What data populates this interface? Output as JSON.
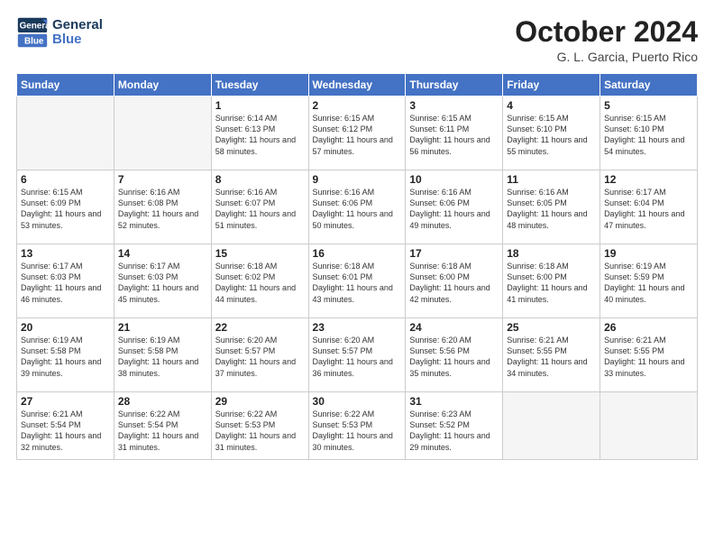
{
  "header": {
    "logo_line1": "General",
    "logo_line2": "Blue",
    "month": "October 2024",
    "location": "G. L. Garcia, Puerto Rico"
  },
  "weekdays": [
    "Sunday",
    "Monday",
    "Tuesday",
    "Wednesday",
    "Thursday",
    "Friday",
    "Saturday"
  ],
  "weeks": [
    [
      {
        "day": "",
        "sunrise": "",
        "sunset": "",
        "daylight": ""
      },
      {
        "day": "",
        "sunrise": "",
        "sunset": "",
        "daylight": ""
      },
      {
        "day": "1",
        "sunrise": "Sunrise: 6:14 AM",
        "sunset": "Sunset: 6:13 PM",
        "daylight": "Daylight: 11 hours and 58 minutes."
      },
      {
        "day": "2",
        "sunrise": "Sunrise: 6:15 AM",
        "sunset": "Sunset: 6:12 PM",
        "daylight": "Daylight: 11 hours and 57 minutes."
      },
      {
        "day": "3",
        "sunrise": "Sunrise: 6:15 AM",
        "sunset": "Sunset: 6:11 PM",
        "daylight": "Daylight: 11 hours and 56 minutes."
      },
      {
        "day": "4",
        "sunrise": "Sunrise: 6:15 AM",
        "sunset": "Sunset: 6:10 PM",
        "daylight": "Daylight: 11 hours and 55 minutes."
      },
      {
        "day": "5",
        "sunrise": "Sunrise: 6:15 AM",
        "sunset": "Sunset: 6:10 PM",
        "daylight": "Daylight: 11 hours and 54 minutes."
      }
    ],
    [
      {
        "day": "6",
        "sunrise": "Sunrise: 6:15 AM",
        "sunset": "Sunset: 6:09 PM",
        "daylight": "Daylight: 11 hours and 53 minutes."
      },
      {
        "day": "7",
        "sunrise": "Sunrise: 6:16 AM",
        "sunset": "Sunset: 6:08 PM",
        "daylight": "Daylight: 11 hours and 52 minutes."
      },
      {
        "day": "8",
        "sunrise": "Sunrise: 6:16 AM",
        "sunset": "Sunset: 6:07 PM",
        "daylight": "Daylight: 11 hours and 51 minutes."
      },
      {
        "day": "9",
        "sunrise": "Sunrise: 6:16 AM",
        "sunset": "Sunset: 6:06 PM",
        "daylight": "Daylight: 11 hours and 50 minutes."
      },
      {
        "day": "10",
        "sunrise": "Sunrise: 6:16 AM",
        "sunset": "Sunset: 6:06 PM",
        "daylight": "Daylight: 11 hours and 49 minutes."
      },
      {
        "day": "11",
        "sunrise": "Sunrise: 6:16 AM",
        "sunset": "Sunset: 6:05 PM",
        "daylight": "Daylight: 11 hours and 48 minutes."
      },
      {
        "day": "12",
        "sunrise": "Sunrise: 6:17 AM",
        "sunset": "Sunset: 6:04 PM",
        "daylight": "Daylight: 11 hours and 47 minutes."
      }
    ],
    [
      {
        "day": "13",
        "sunrise": "Sunrise: 6:17 AM",
        "sunset": "Sunset: 6:03 PM",
        "daylight": "Daylight: 11 hours and 46 minutes."
      },
      {
        "day": "14",
        "sunrise": "Sunrise: 6:17 AM",
        "sunset": "Sunset: 6:03 PM",
        "daylight": "Daylight: 11 hours and 45 minutes."
      },
      {
        "day": "15",
        "sunrise": "Sunrise: 6:18 AM",
        "sunset": "Sunset: 6:02 PM",
        "daylight": "Daylight: 11 hours and 44 minutes."
      },
      {
        "day": "16",
        "sunrise": "Sunrise: 6:18 AM",
        "sunset": "Sunset: 6:01 PM",
        "daylight": "Daylight: 11 hours and 43 minutes."
      },
      {
        "day": "17",
        "sunrise": "Sunrise: 6:18 AM",
        "sunset": "Sunset: 6:00 PM",
        "daylight": "Daylight: 11 hours and 42 minutes."
      },
      {
        "day": "18",
        "sunrise": "Sunrise: 6:18 AM",
        "sunset": "Sunset: 6:00 PM",
        "daylight": "Daylight: 11 hours and 41 minutes."
      },
      {
        "day": "19",
        "sunrise": "Sunrise: 6:19 AM",
        "sunset": "Sunset: 5:59 PM",
        "daylight": "Daylight: 11 hours and 40 minutes."
      }
    ],
    [
      {
        "day": "20",
        "sunrise": "Sunrise: 6:19 AM",
        "sunset": "Sunset: 5:58 PM",
        "daylight": "Daylight: 11 hours and 39 minutes."
      },
      {
        "day": "21",
        "sunrise": "Sunrise: 6:19 AM",
        "sunset": "Sunset: 5:58 PM",
        "daylight": "Daylight: 11 hours and 38 minutes."
      },
      {
        "day": "22",
        "sunrise": "Sunrise: 6:20 AM",
        "sunset": "Sunset: 5:57 PM",
        "daylight": "Daylight: 11 hours and 37 minutes."
      },
      {
        "day": "23",
        "sunrise": "Sunrise: 6:20 AM",
        "sunset": "Sunset: 5:57 PM",
        "daylight": "Daylight: 11 hours and 36 minutes."
      },
      {
        "day": "24",
        "sunrise": "Sunrise: 6:20 AM",
        "sunset": "Sunset: 5:56 PM",
        "daylight": "Daylight: 11 hours and 35 minutes."
      },
      {
        "day": "25",
        "sunrise": "Sunrise: 6:21 AM",
        "sunset": "Sunset: 5:55 PM",
        "daylight": "Daylight: 11 hours and 34 minutes."
      },
      {
        "day": "26",
        "sunrise": "Sunrise: 6:21 AM",
        "sunset": "Sunset: 5:55 PM",
        "daylight": "Daylight: 11 hours and 33 minutes."
      }
    ],
    [
      {
        "day": "27",
        "sunrise": "Sunrise: 6:21 AM",
        "sunset": "Sunset: 5:54 PM",
        "daylight": "Daylight: 11 hours and 32 minutes."
      },
      {
        "day": "28",
        "sunrise": "Sunrise: 6:22 AM",
        "sunset": "Sunset: 5:54 PM",
        "daylight": "Daylight: 11 hours and 31 minutes."
      },
      {
        "day": "29",
        "sunrise": "Sunrise: 6:22 AM",
        "sunset": "Sunset: 5:53 PM",
        "daylight": "Daylight: 11 hours and 31 minutes."
      },
      {
        "day": "30",
        "sunrise": "Sunrise: 6:22 AM",
        "sunset": "Sunset: 5:53 PM",
        "daylight": "Daylight: 11 hours and 30 minutes."
      },
      {
        "day": "31",
        "sunrise": "Sunrise: 6:23 AM",
        "sunset": "Sunset: 5:52 PM",
        "daylight": "Daylight: 11 hours and 29 minutes."
      },
      {
        "day": "",
        "sunrise": "",
        "sunset": "",
        "daylight": ""
      },
      {
        "day": "",
        "sunrise": "",
        "sunset": "",
        "daylight": ""
      }
    ]
  ]
}
